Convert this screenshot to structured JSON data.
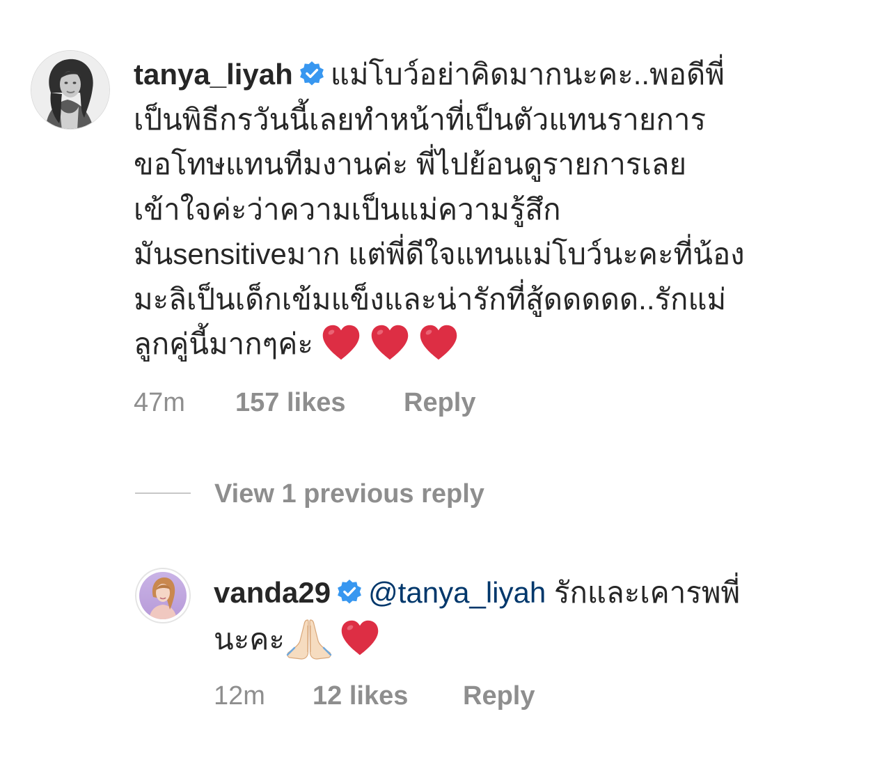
{
  "comments": [
    {
      "username": "tanya_liyah",
      "verified": true,
      "text_lines": [
        "แม่โบว์อย่าคิดมากนะคะ..พอดีพี่",
        "เป็นพิธีกรวันนี้เลยทำหน้าที่เป็นตัวแทนรายการ",
        "ขอโทษแทนทีมงานค่ะ พี่ไปย้อนดูรายการเลย",
        "เข้าใจค่ะว่าความเป็นแม่ความรู้สึก",
        "มันsensitiveมาก แต่พี่ดีใจแทนแม่โบว์นะคะที่น้อง",
        "มะลิเป็นเด็กเข้มแข็งและน่ารักที่สู้ดดดดด..รักแม่",
        "ลูกคู่นี้มากๆค่ะ"
      ],
      "emoji": [
        "red-heart",
        "red-heart",
        "red-heart"
      ],
      "time": "47m",
      "likes": "157 likes",
      "reply_label": "Reply"
    },
    {
      "username": "vanda29",
      "verified": true,
      "mention": "@tanya_liyah",
      "text_line_1": " รักและเคารพพี่",
      "text_line_2": "นะคะ",
      "emoji": [
        "folded-hands",
        "red-heart"
      ],
      "time": "12m",
      "likes": "12 likes",
      "reply_label": "Reply"
    }
  ],
  "view_replies_label": "View 1 previous reply",
  "colors": {
    "text": "#262626",
    "secondary": "#8e8e8e",
    "mention": "#00376b",
    "verified": "#3897f0",
    "heart": "#dd2e44"
  }
}
